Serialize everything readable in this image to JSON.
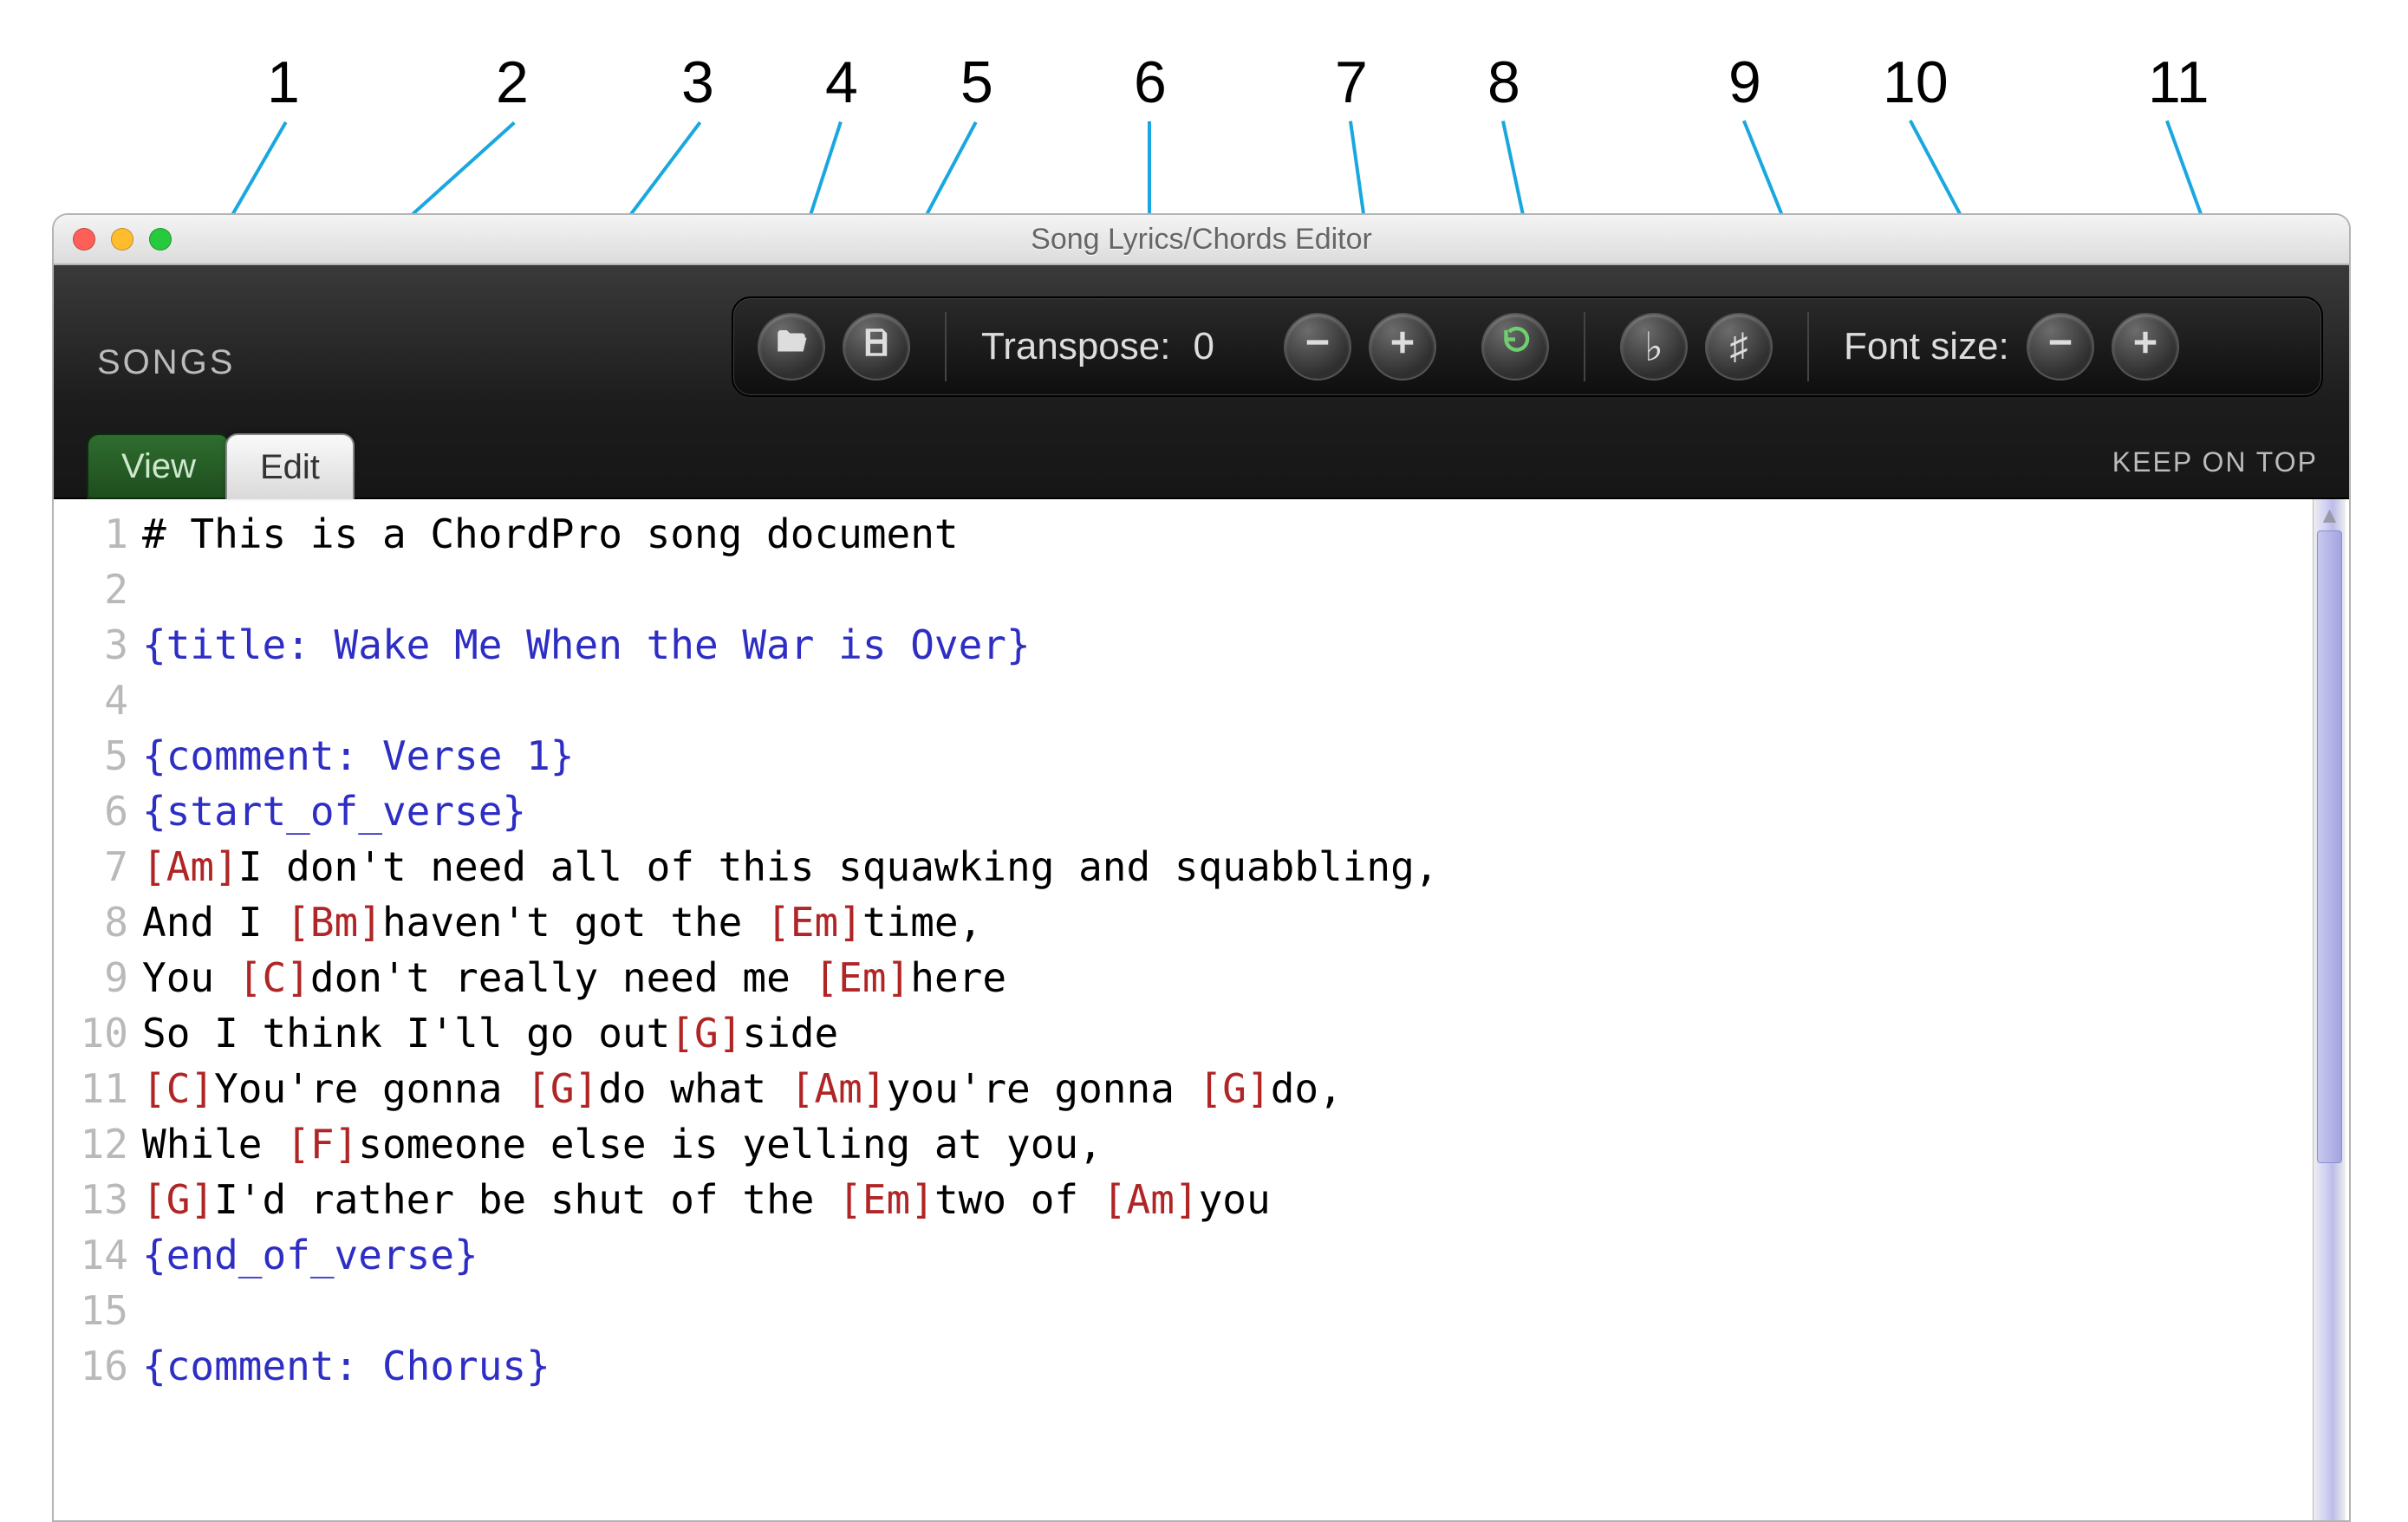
{
  "callout_labels": [
    "1",
    "2",
    "3",
    "4",
    "5",
    "6",
    "7",
    "8",
    "9",
    "10",
    "11"
  ],
  "window": {
    "title": "Song Lyrics/Chords Editor"
  },
  "toolbar": {
    "songs_label": "SONGS",
    "transpose_label": "Transpose:",
    "transpose_value": "0",
    "font_size_label": "Font size:",
    "keep_on_top": "KEEP ON TOP",
    "icons": {
      "open": "folder-open-icon",
      "save": "floppy-icon",
      "minus": "minus-icon",
      "plus": "plus-icon",
      "reset": "reset-icon",
      "flat": "flat-icon",
      "sharp": "sharp-icon",
      "font_minus": "minus-icon",
      "font_plus": "plus-icon"
    }
  },
  "tabs": {
    "view": "View",
    "edit": "Edit",
    "active": "edit"
  },
  "editor": {
    "lines": [
      {
        "n": 1,
        "seg": [
          {
            "t": "# This is a ChordPro song document",
            "c": "comment"
          }
        ]
      },
      {
        "n": 2,
        "seg": []
      },
      {
        "n": 3,
        "seg": [
          {
            "t": "{title: Wake Me When the War is Over}",
            "c": "directive"
          }
        ]
      },
      {
        "n": 4,
        "seg": []
      },
      {
        "n": 5,
        "seg": [
          {
            "t": "{comment: Verse 1}",
            "c": "directive"
          }
        ]
      },
      {
        "n": 6,
        "seg": [
          {
            "t": "{start_of_verse}",
            "c": "directive"
          }
        ]
      },
      {
        "n": 7,
        "seg": [
          {
            "t": "[Am]",
            "c": "chord"
          },
          {
            "t": "I don't need all of this squawking and squabbling,"
          }
        ]
      },
      {
        "n": 8,
        "seg": [
          {
            "t": "And I "
          },
          {
            "t": "[Bm]",
            "c": "chord"
          },
          {
            "t": "haven't got the "
          },
          {
            "t": "[Em]",
            "c": "chord"
          },
          {
            "t": "time,"
          }
        ]
      },
      {
        "n": 9,
        "seg": [
          {
            "t": "You "
          },
          {
            "t": "[C]",
            "c": "chord"
          },
          {
            "t": "don't really need me "
          },
          {
            "t": "[Em]",
            "c": "chord"
          },
          {
            "t": "here"
          }
        ]
      },
      {
        "n": 10,
        "seg": [
          {
            "t": "So I think I'll go out"
          },
          {
            "t": "[G]",
            "c": "chord"
          },
          {
            "t": "side"
          }
        ]
      },
      {
        "n": 11,
        "seg": [
          {
            "t": "[C]",
            "c": "chord"
          },
          {
            "t": "You're gonna "
          },
          {
            "t": "[G]",
            "c": "chord"
          },
          {
            "t": "do what "
          },
          {
            "t": "[Am]",
            "c": "chord"
          },
          {
            "t": "you're gonna "
          },
          {
            "t": "[G]",
            "c": "chord"
          },
          {
            "t": "do,"
          }
        ]
      },
      {
        "n": 12,
        "seg": [
          {
            "t": "While "
          },
          {
            "t": "[F]",
            "c": "chord"
          },
          {
            "t": "someone else is yelling at you,"
          }
        ]
      },
      {
        "n": 13,
        "seg": [
          {
            "t": "[G]",
            "c": "chord"
          },
          {
            "t": "I'd rather be shut of the "
          },
          {
            "t": "[Em]",
            "c": "chord"
          },
          {
            "t": "two of "
          },
          {
            "t": "[Am]",
            "c": "chord"
          },
          {
            "t": "you"
          }
        ]
      },
      {
        "n": 14,
        "seg": [
          {
            "t": "{end_of_verse}",
            "c": "directive"
          }
        ]
      },
      {
        "n": 15,
        "seg": []
      },
      {
        "n": 16,
        "seg": [
          {
            "t": "{comment: Chorus}",
            "c": "directive"
          }
        ]
      }
    ]
  }
}
